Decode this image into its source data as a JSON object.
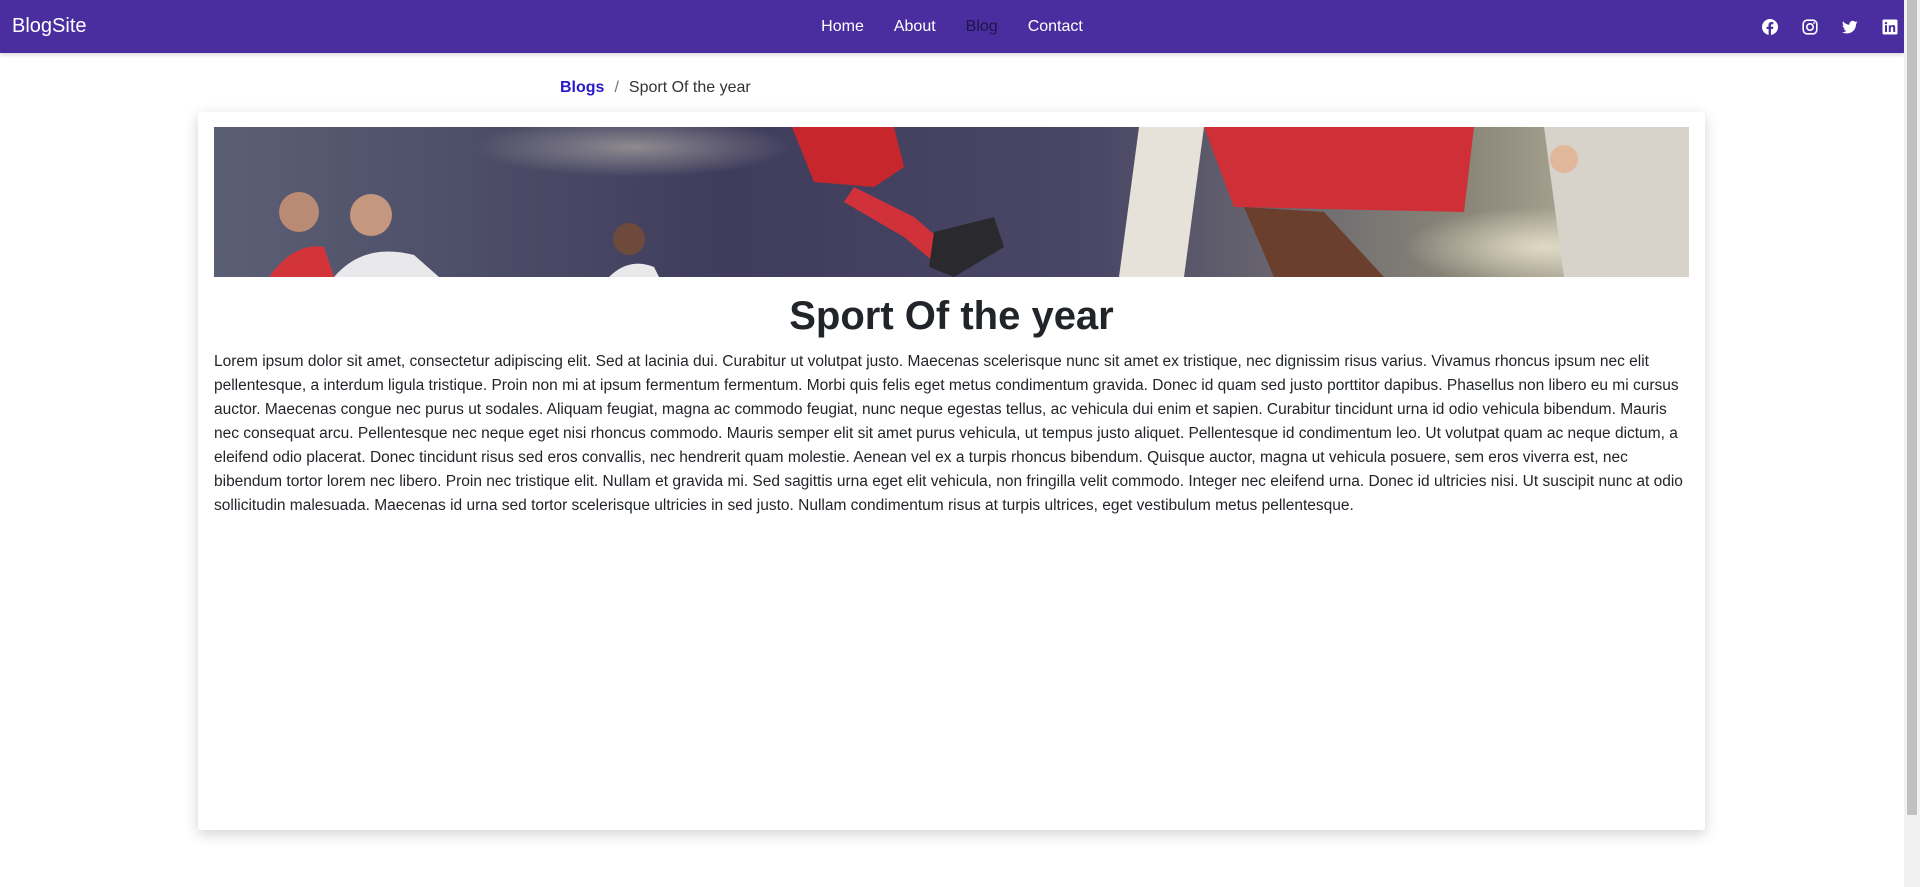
{
  "nav": {
    "brand": "BlogSite",
    "links": [
      {
        "label": "Home",
        "active": false
      },
      {
        "label": "About",
        "active": false
      },
      {
        "label": "Blog",
        "active": true
      },
      {
        "label": "Contact",
        "active": false
      }
    ],
    "social_icons": [
      "facebook-icon",
      "instagram-icon",
      "twitter-icon",
      "linkedin-icon"
    ]
  },
  "breadcrumb": {
    "parent": "Blogs",
    "separator": "/",
    "current": "Sport Of the year"
  },
  "post": {
    "title": "Sport Of the year",
    "body": "Lorem ipsum dolor sit amet, consectetur adipiscing elit. Sed at lacinia dui. Curabitur ut volutpat justo. Maecenas scelerisque nunc sit amet ex tristique, nec dignissim risus varius. Vivamus rhoncus ipsum nec elit pellentesque, a interdum ligula tristique. Proin non mi at ipsum fermentum fermentum. Morbi quis felis eget metus condimentum gravida. Donec id quam sed justo porttitor dapibus. Phasellus non libero eu mi cursus auctor. Maecenas congue nec purus ut sodales. Aliquam feugiat, magna ac commodo feugiat, nunc neque egestas tellus, ac vehicula dui enim et sapien. Curabitur tincidunt urna id odio vehicula bibendum. Mauris nec consequat arcu. Pellentesque nec neque eget nisi rhoncus commodo. Mauris semper elit sit amet purus vehicula, ut tempus justo aliquet. Pellentesque id condimentum leo. Ut volutpat quam ac neque dictum, a eleifend odio placerat. Donec tincidunt risus sed eros convallis, nec hendrerit quam molestie. Aenean vel ex a turpis rhoncus bibendum. Quisque auctor, magna ut vehicula posuere, sem eros viverra est, nec bibendum tortor lorem nec libero. Proin nec tristique elit. Nullam et gravida mi. Sed sagittis urna eget elit vehicula, non fringilla velit commodo. Integer nec eleifend urna. Donec id ultricies nisi. Ut suscipit nunc at odio sollicitudin malesuada. Maecenas id urna sed tortor scelerisque ultricies in sed justo. Nullam condimentum risus at turpis ultrices, eget vestibulum metus pellentesque."
  },
  "colors": {
    "navbar": "#4a2ea0",
    "nav_active": "#1f1546",
    "link": "#2818c8"
  }
}
